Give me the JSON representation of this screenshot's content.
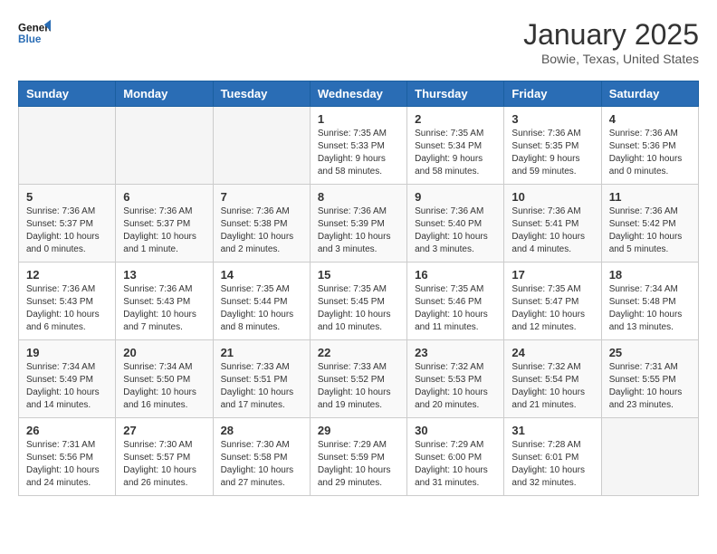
{
  "header": {
    "logo_line1": "General",
    "logo_line2": "Blue",
    "title": "January 2025",
    "subtitle": "Bowie, Texas, United States"
  },
  "days_of_week": [
    "Sunday",
    "Monday",
    "Tuesday",
    "Wednesday",
    "Thursday",
    "Friday",
    "Saturday"
  ],
  "weeks": [
    [
      {
        "day": "",
        "info": ""
      },
      {
        "day": "",
        "info": ""
      },
      {
        "day": "",
        "info": ""
      },
      {
        "day": "1",
        "info": "Sunrise: 7:35 AM\nSunset: 5:33 PM\nDaylight: 9 hours\nand 58 minutes."
      },
      {
        "day": "2",
        "info": "Sunrise: 7:35 AM\nSunset: 5:34 PM\nDaylight: 9 hours\nand 58 minutes."
      },
      {
        "day": "3",
        "info": "Sunrise: 7:36 AM\nSunset: 5:35 PM\nDaylight: 9 hours\nand 59 minutes."
      },
      {
        "day": "4",
        "info": "Sunrise: 7:36 AM\nSunset: 5:36 PM\nDaylight: 10 hours\nand 0 minutes."
      }
    ],
    [
      {
        "day": "5",
        "info": "Sunrise: 7:36 AM\nSunset: 5:37 PM\nDaylight: 10 hours\nand 0 minutes."
      },
      {
        "day": "6",
        "info": "Sunrise: 7:36 AM\nSunset: 5:37 PM\nDaylight: 10 hours\nand 1 minute."
      },
      {
        "day": "7",
        "info": "Sunrise: 7:36 AM\nSunset: 5:38 PM\nDaylight: 10 hours\nand 2 minutes."
      },
      {
        "day": "8",
        "info": "Sunrise: 7:36 AM\nSunset: 5:39 PM\nDaylight: 10 hours\nand 3 minutes."
      },
      {
        "day": "9",
        "info": "Sunrise: 7:36 AM\nSunset: 5:40 PM\nDaylight: 10 hours\nand 3 minutes."
      },
      {
        "day": "10",
        "info": "Sunrise: 7:36 AM\nSunset: 5:41 PM\nDaylight: 10 hours\nand 4 minutes."
      },
      {
        "day": "11",
        "info": "Sunrise: 7:36 AM\nSunset: 5:42 PM\nDaylight: 10 hours\nand 5 minutes."
      }
    ],
    [
      {
        "day": "12",
        "info": "Sunrise: 7:36 AM\nSunset: 5:43 PM\nDaylight: 10 hours\nand 6 minutes."
      },
      {
        "day": "13",
        "info": "Sunrise: 7:36 AM\nSunset: 5:43 PM\nDaylight: 10 hours\nand 7 minutes."
      },
      {
        "day": "14",
        "info": "Sunrise: 7:35 AM\nSunset: 5:44 PM\nDaylight: 10 hours\nand 8 minutes."
      },
      {
        "day": "15",
        "info": "Sunrise: 7:35 AM\nSunset: 5:45 PM\nDaylight: 10 hours\nand 10 minutes."
      },
      {
        "day": "16",
        "info": "Sunrise: 7:35 AM\nSunset: 5:46 PM\nDaylight: 10 hours\nand 11 minutes."
      },
      {
        "day": "17",
        "info": "Sunrise: 7:35 AM\nSunset: 5:47 PM\nDaylight: 10 hours\nand 12 minutes."
      },
      {
        "day": "18",
        "info": "Sunrise: 7:34 AM\nSunset: 5:48 PM\nDaylight: 10 hours\nand 13 minutes."
      }
    ],
    [
      {
        "day": "19",
        "info": "Sunrise: 7:34 AM\nSunset: 5:49 PM\nDaylight: 10 hours\nand 14 minutes."
      },
      {
        "day": "20",
        "info": "Sunrise: 7:34 AM\nSunset: 5:50 PM\nDaylight: 10 hours\nand 16 minutes."
      },
      {
        "day": "21",
        "info": "Sunrise: 7:33 AM\nSunset: 5:51 PM\nDaylight: 10 hours\nand 17 minutes."
      },
      {
        "day": "22",
        "info": "Sunrise: 7:33 AM\nSunset: 5:52 PM\nDaylight: 10 hours\nand 19 minutes."
      },
      {
        "day": "23",
        "info": "Sunrise: 7:32 AM\nSunset: 5:53 PM\nDaylight: 10 hours\nand 20 minutes."
      },
      {
        "day": "24",
        "info": "Sunrise: 7:32 AM\nSunset: 5:54 PM\nDaylight: 10 hours\nand 21 minutes."
      },
      {
        "day": "25",
        "info": "Sunrise: 7:31 AM\nSunset: 5:55 PM\nDaylight: 10 hours\nand 23 minutes."
      }
    ],
    [
      {
        "day": "26",
        "info": "Sunrise: 7:31 AM\nSunset: 5:56 PM\nDaylight: 10 hours\nand 24 minutes."
      },
      {
        "day": "27",
        "info": "Sunrise: 7:30 AM\nSunset: 5:57 PM\nDaylight: 10 hours\nand 26 minutes."
      },
      {
        "day": "28",
        "info": "Sunrise: 7:30 AM\nSunset: 5:58 PM\nDaylight: 10 hours\nand 27 minutes."
      },
      {
        "day": "29",
        "info": "Sunrise: 7:29 AM\nSunset: 5:59 PM\nDaylight: 10 hours\nand 29 minutes."
      },
      {
        "day": "30",
        "info": "Sunrise: 7:29 AM\nSunset: 6:00 PM\nDaylight: 10 hours\nand 31 minutes."
      },
      {
        "day": "31",
        "info": "Sunrise: 7:28 AM\nSunset: 6:01 PM\nDaylight: 10 hours\nand 32 minutes."
      },
      {
        "day": "",
        "info": ""
      }
    ]
  ]
}
